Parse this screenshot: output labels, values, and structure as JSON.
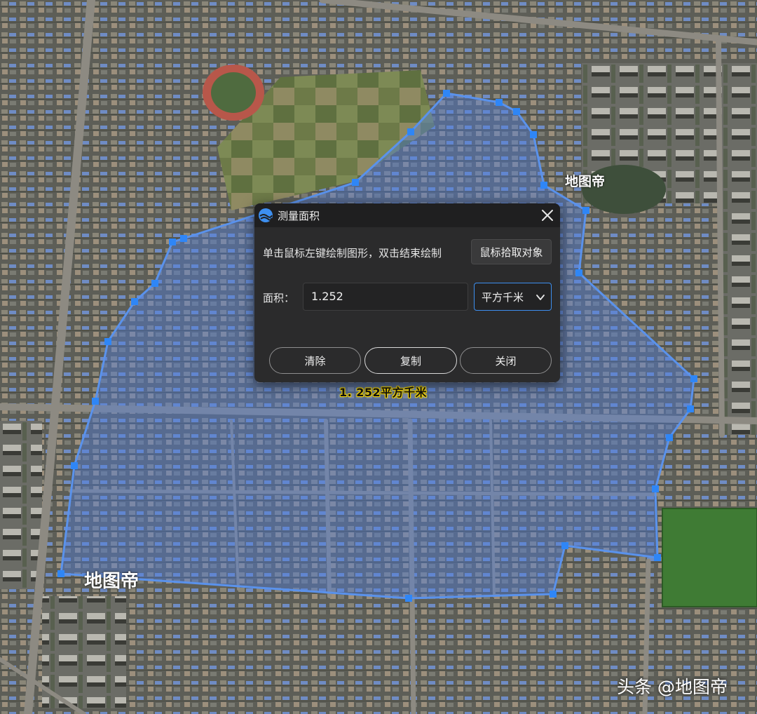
{
  "map": {
    "watermarks": [
      "地图帝",
      "地图帝"
    ],
    "brand": "头条 @地图帝",
    "measure_label": "1. 252平方千米",
    "polygon_color": "#4f7fe0",
    "vertex_color": "#2f86f6"
  },
  "dialog": {
    "title": "测量面积",
    "logo_icon": "app-logo-icon",
    "close_icon": "close-icon",
    "hint": "单击鼠标左键绘制图形，双击结束绘制",
    "pick_button": "鼠标拾取对象",
    "area_label": "面积：",
    "area_value": "1.252",
    "unit": "平方千米",
    "buttons": {
      "clear": "清除",
      "copy": "复制",
      "close": "关闭"
    }
  }
}
